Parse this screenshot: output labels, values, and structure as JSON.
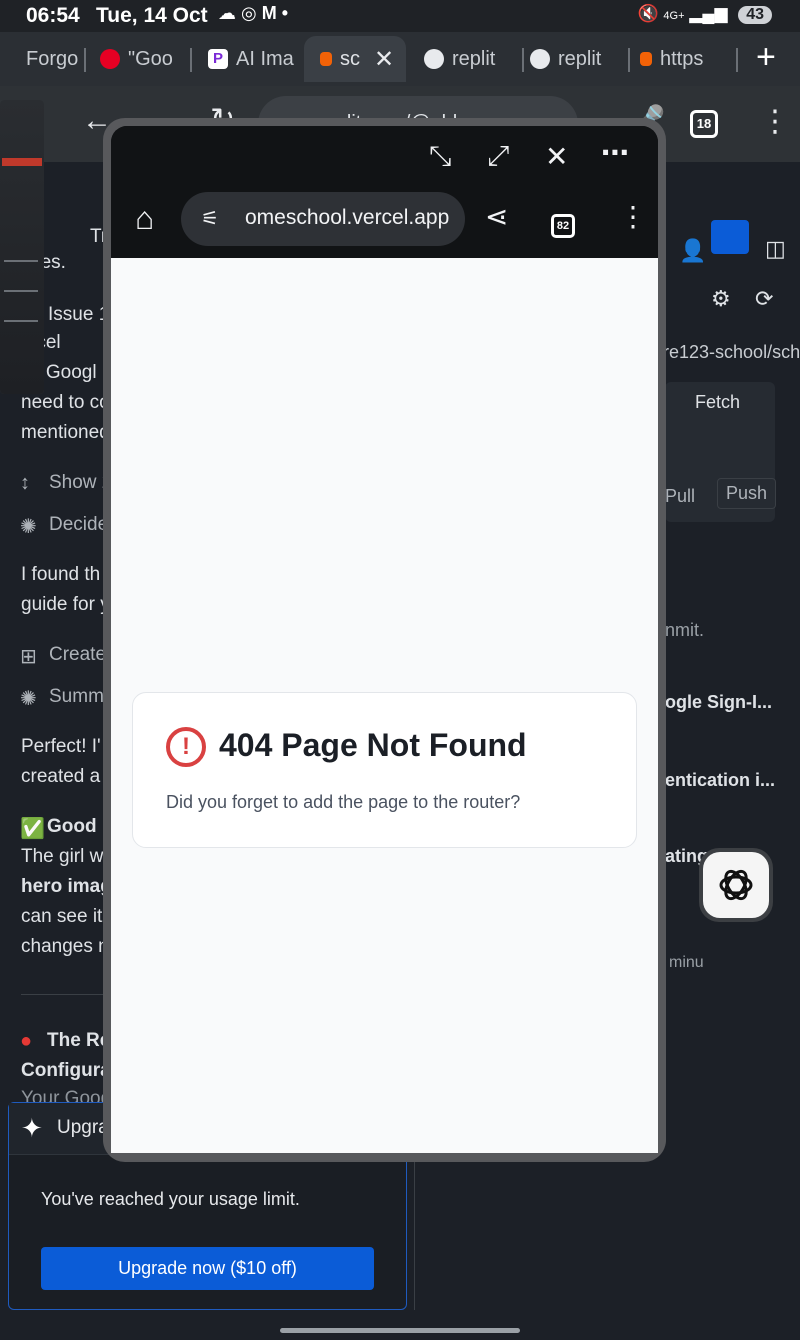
{
  "status": {
    "time": "06:54",
    "date": "Tue, 14 Oct",
    "network": "4G+",
    "battery": "43"
  },
  "tabs": [
    {
      "label": "Forgo"
    },
    {
      "label": "\"Goo"
    },
    {
      "label": "AI Ima"
    },
    {
      "label": "sc"
    },
    {
      "label": "replit"
    },
    {
      "label": "replit"
    },
    {
      "label": "https"
    }
  ],
  "toolbar": {
    "url": "replit.com/@old",
    "tab_count": "18"
  },
  "background": {
    "lines": [
      "Tr",
      "ues.",
      "Issue 1",
      "rcel",
      "e Googl",
      "need to co",
      "mentioned",
      "Show 2",
      "Decide",
      "I found th",
      "guide for y",
      "Create",
      "Summ",
      "Perfect! I'",
      "created a",
      "Good N",
      "The girl w",
      "hero imag",
      "can see it",
      "changes n",
      "The Re",
      "Configura",
      "Your Goog"
    ],
    "right": [
      "re123-school/sch",
      "Fetch",
      "Pull",
      "Push",
      "nmit.",
      "ogle Sign-I...",
      "entication i...",
      "ating Repli...",
      "minu"
    ],
    "upgrade_title": "Upgra",
    "upgrade_msg": "You've reached your usage limit.",
    "upgrade_btn": "Upgrade now ($10 off)"
  },
  "popup": {
    "url": "omeschool.vercel.app",
    "tab_count": "82",
    "error_title": "404 Page Not Found",
    "error_message": "Did you forget to add the page to the router?"
  }
}
